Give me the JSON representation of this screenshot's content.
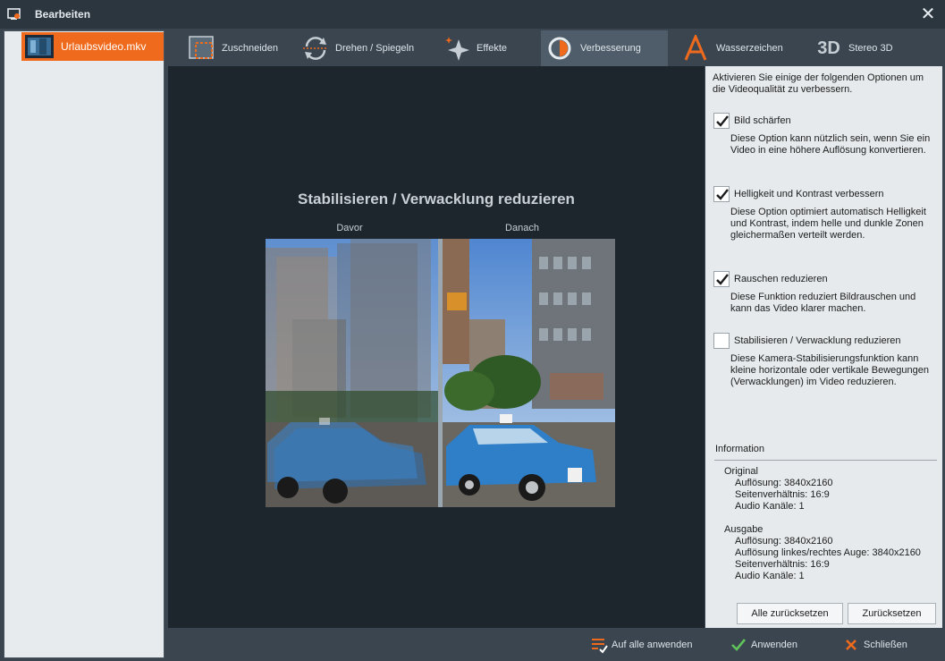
{
  "window": {
    "title": "Bearbeiten"
  },
  "sidebar": {
    "file_name": "Urlaubsvideo.mkv"
  },
  "tabs": [
    {
      "label": "Zuschneiden",
      "icon": "crop-icon"
    },
    {
      "label": "Drehen / Spiegeln",
      "icon": "rotate-icon"
    },
    {
      "label": "Effekte",
      "icon": "sparkle-icon"
    },
    {
      "label": "Verbesserung",
      "icon": "contrast-icon",
      "active": true
    },
    {
      "label": "Wasserzeichen",
      "icon": "watermark-icon"
    },
    {
      "label": "Stereo 3D",
      "icon": "stereo-3d-icon",
      "icon_text": "3D"
    }
  ],
  "preview": {
    "title": "Stabilisieren / Verwacklung reduzieren",
    "before_label": "Davor",
    "after_label": "Danach"
  },
  "options": {
    "intro": "Aktivieren Sie einige der folgenden Optionen um die Videoqualität zu verbessern.",
    "items": [
      {
        "label": "Bild schärfen",
        "checked": true,
        "desc": "Diese Option kann nützlich sein, wenn Sie ein Video in eine höhere Auflösung konvertieren."
      },
      {
        "label": "Helligkeit und Kontrast verbessern",
        "checked": true,
        "desc": "Diese Option optimiert automatisch Helligkeit und Kontrast, indem helle und dunkle Zonen gleichermaßen verteilt werden."
      },
      {
        "label": "Rauschen reduzieren",
        "checked": true,
        "desc": "Diese Funktion reduziert Bildrauschen und kann das Video klarer machen."
      },
      {
        "label": "Stabilisieren / Verwacklung reduzieren",
        "checked": false,
        "desc": "Diese Kamera-Stabilisierungsfunktion kann kleine horizontale oder vertikale Bewegungen (Verwacklungen) im Video reduzieren."
      }
    ]
  },
  "information": {
    "heading": "Information",
    "original": {
      "heading": "Original",
      "resolution": "Auflösung: 3840x2160",
      "aspect": "Seitenverhältnis: 16:9",
      "audio": "Audio Kanäle: 1"
    },
    "output": {
      "heading": "Ausgabe",
      "resolution": "Auflösung: 3840x2160",
      "eye_resolution": "Auflösung linkes/rechtes Auge: 3840x2160",
      "aspect": "Seitenverhältnis: 16:9",
      "audio": "Audio Kanäle: 1"
    }
  },
  "buttons": {
    "reset_all": "Alle zurücksetzen",
    "reset": "Zurücksetzen",
    "apply_all": "Auf alle anwenden",
    "apply": "Anwenden",
    "close": "Schließen"
  },
  "colors": {
    "accent": "#ef6a1c",
    "apply_green": "#5fc35a",
    "close_orange": "#ef6a1c"
  }
}
